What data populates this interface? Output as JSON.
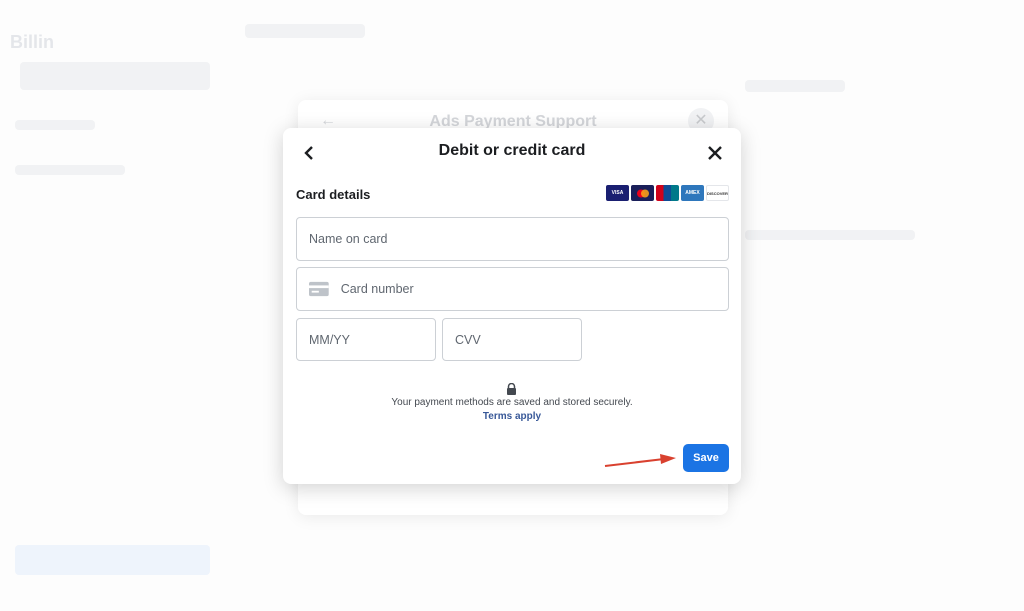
{
  "background": {
    "sidebar_title": "Billin",
    "support_panel_title": "Ads Payment Support"
  },
  "modal": {
    "title": "Debit or credit card",
    "section_title": "Card details",
    "card_brands": [
      "VISA",
      "mastercard",
      "UnionPay",
      "AMEX",
      "DISCOVER"
    ],
    "name_placeholder": "Name on card",
    "card_number_placeholder": "Card number",
    "expiry_placeholder": "MM/YY",
    "cvv_placeholder": "CVV",
    "security_note": "Your payment methods are saved and stored securely.",
    "terms_link": "Terms apply",
    "save_label": "Save"
  },
  "colors": {
    "primary": "#1b74e4",
    "link": "#385898",
    "annotation_arrow": "#d9412f"
  }
}
